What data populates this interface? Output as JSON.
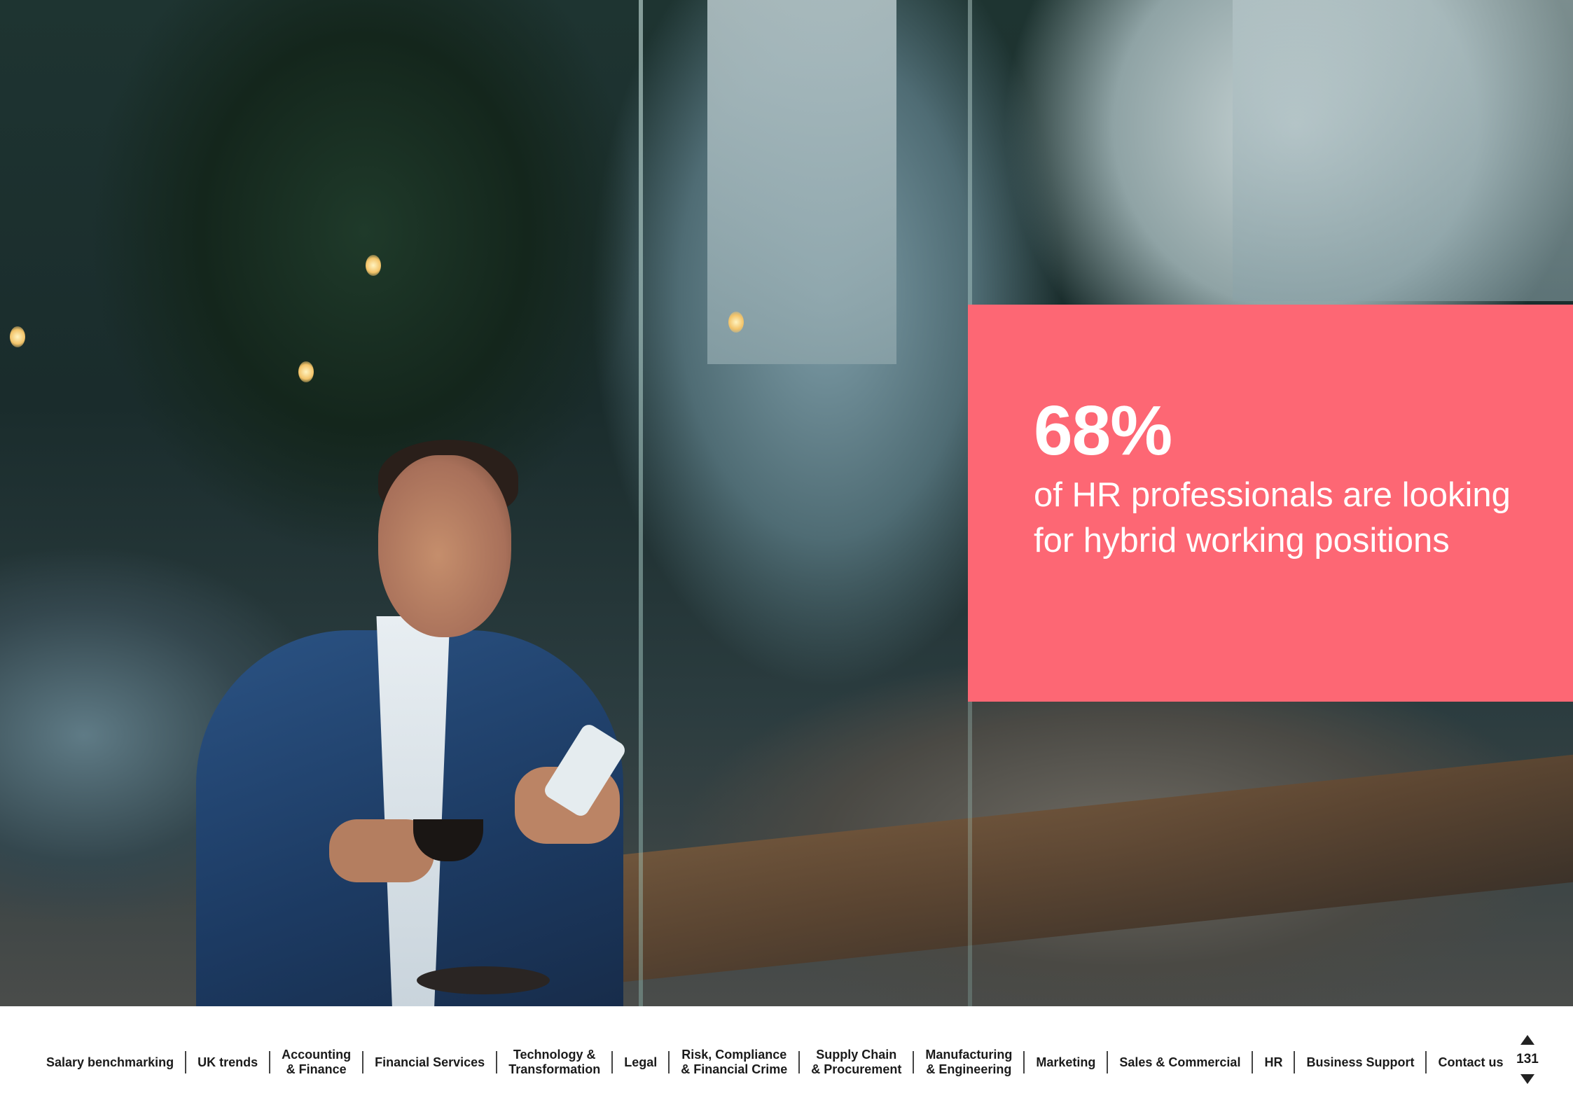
{
  "stat": {
    "value": "68%",
    "caption": "of HR professionals are looking for hybrid working positions",
    "panel_color": "#fd6774"
  },
  "nav": {
    "items": [
      {
        "label": "Salary benchmarking"
      },
      {
        "label": "UK trends"
      },
      {
        "label": "Accounting\n& Finance"
      },
      {
        "label": "Financial Services"
      },
      {
        "label": "Technology &\nTransformation"
      },
      {
        "label": "Legal"
      },
      {
        "label": "Risk, Compliance\n& Financial Crime"
      },
      {
        "label": "Supply Chain\n& Procurement"
      },
      {
        "label": "Manufacturing\n& Engineering"
      },
      {
        "label": "Marketing"
      },
      {
        "label": "Sales & Commercial"
      },
      {
        "label": "HR"
      },
      {
        "label": "Business Support"
      },
      {
        "label": "Contact us"
      }
    ]
  },
  "pager": {
    "page_number": "131",
    "prev_icon": "triangle-up",
    "next_icon": "triangle-down"
  }
}
